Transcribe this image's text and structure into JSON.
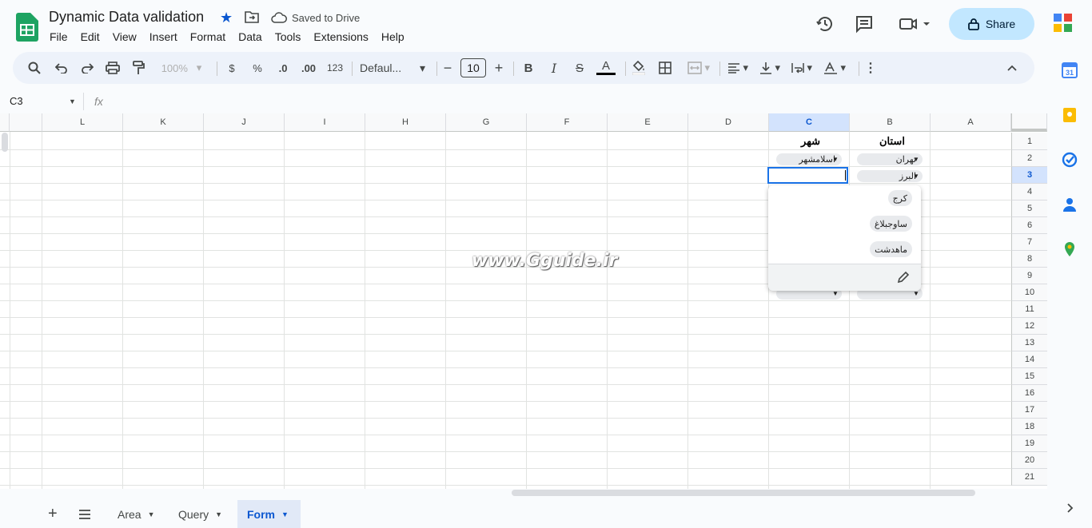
{
  "doc": {
    "title": "Dynamic Data validation",
    "save_status": "Saved to Drive"
  },
  "menu": [
    "File",
    "Edit",
    "View",
    "Insert",
    "Format",
    "Data",
    "Tools",
    "Extensions",
    "Help"
  ],
  "share_label": "Share",
  "toolbar": {
    "zoom": "100%",
    "currency": "$",
    "percent": "%",
    "dec_decrease": ".0",
    "dec_increase": ".00",
    "number_format": "123",
    "font": "Defaul...",
    "font_size": "10",
    "minus": "−",
    "plus": "+",
    "bold": "B",
    "italic": "I",
    "strike": "S",
    "text_color": "A"
  },
  "name_box": "C3",
  "formula_label": "fx",
  "columns": [
    "L",
    "K",
    "J",
    "I",
    "H",
    "G",
    "F",
    "E",
    "D",
    "C",
    "B",
    "A"
  ],
  "selected_column": "C",
  "rows": [
    "1",
    "2",
    "3",
    "4",
    "5",
    "6",
    "7",
    "8",
    "9",
    "10",
    "11",
    "12",
    "13",
    "14",
    "15",
    "16",
    "17",
    "18",
    "19",
    "20",
    "21"
  ],
  "selected_row": "3",
  "cells": {
    "B1": "استان",
    "C1": "شهر",
    "B2": "تهران",
    "C2": "اسلامشهر",
    "B3": "البرز"
  },
  "dropdown_options": [
    "کرج",
    "ساوجبلاغ",
    "ماهدشت"
  ],
  "watermark": "www.Gguide.ir",
  "sheet_tabs": [
    {
      "label": "Area",
      "active": false
    },
    {
      "label": "Query",
      "active": false
    },
    {
      "label": "Form",
      "active": true
    }
  ],
  "colors": {
    "accent": "#0b57d0",
    "share_bg": "#c2e7ff",
    "selection": "#1a73e8"
  }
}
